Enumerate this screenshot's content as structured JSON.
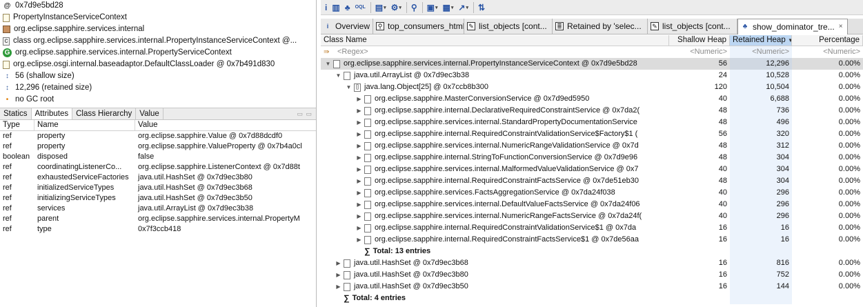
{
  "left": {
    "info": [
      {
        "icon": "at-icon",
        "glyph": "@",
        "text": "0x7d9e5bd28"
      },
      {
        "icon": "document-icon",
        "glyph": "",
        "text": "PropertyInstanceServiceContext"
      },
      {
        "icon": "package-icon",
        "glyph": "",
        "text": "org.eclipse.sapphire.services.internal"
      },
      {
        "icon": "class-icon",
        "glyph": "c",
        "text": "class org.eclipse.sapphire.services.internal.PropertyInstanceServiceContext @..."
      },
      {
        "icon": "superclass-icon",
        "glyph": "G",
        "text": "org.eclipse.sapphire.services.internal.PropertyServiceContext"
      },
      {
        "icon": "classloader-icon",
        "glyph": "",
        "text": "org.eclipse.osgi.internal.baseadaptor.DefaultClassLoader @ 0x7b491d830"
      },
      {
        "icon": "shallow-size-icon",
        "glyph": "↕",
        "text": "56 (shallow size)"
      },
      {
        "icon": "retained-size-icon",
        "glyph": "↕",
        "text": "12,296 (retained size)"
      },
      {
        "icon": "gc-root-icon",
        "glyph": "•",
        "text": "no GC root"
      }
    ],
    "tabs": [
      "Statics",
      "Attributes",
      "Class Hierarchy",
      "Value"
    ],
    "active_tab": 1,
    "columns": [
      "Type",
      "Name",
      "Value"
    ],
    "rows": [
      {
        "type": "ref",
        "name": "property",
        "value": "org.eclipse.sapphire.Value @ 0x7d88dcdf0"
      },
      {
        "type": "ref",
        "name": "property",
        "value": "org.eclipse.sapphire.ValueProperty @ 0x7b4a0cl"
      },
      {
        "type": "boolean",
        "name": "disposed",
        "value": "false"
      },
      {
        "type": "ref",
        "name": "coordinatingListenerCo...",
        "value": "org.eclipse.sapphire.ListenerContext @ 0x7d88t"
      },
      {
        "type": "ref",
        "name": "exhaustedServiceFactories",
        "value": "java.util.HashSet @ 0x7d9ec3b80"
      },
      {
        "type": "ref",
        "name": "initializedServiceTypes",
        "value": "java.util.HashSet @ 0x7d9ec3b68"
      },
      {
        "type": "ref",
        "name": "initializingServiceTypes",
        "value": "java.util.HashSet @ 0x7d9ec3b50"
      },
      {
        "type": "ref",
        "name": "services",
        "value": "java.util.ArrayList @ 0x7d9ec3b38"
      },
      {
        "type": "ref",
        "name": "parent",
        "value": "org.eclipse.sapphire.services.internal.PropertyM"
      },
      {
        "type": "ref",
        "name": "type",
        "value": "0x7f3ccb418"
      }
    ]
  },
  "toolbar": {
    "buttons": [
      {
        "name": "info-button",
        "icon": "info-icon",
        "glyph": "i",
        "dropdown": false
      },
      {
        "name": "histogram-button",
        "icon": "histogram-icon",
        "glyph": "▥",
        "dropdown": false
      },
      {
        "name": "dominator-tree-button",
        "icon": "dominator-tree-icon",
        "glyph": "♣",
        "dropdown": false
      },
      {
        "name": "oql-button",
        "icon": "oql-icon",
        "glyph": "OQL",
        "dropdown": false
      },
      {
        "name": "reports-button",
        "icon": "reports-icon",
        "glyph": "▤",
        "dropdown": true
      },
      {
        "name": "query-browser-button",
        "icon": "gear-icon",
        "glyph": "⚙",
        "dropdown": true
      },
      {
        "name": "search-button",
        "icon": "search-icon",
        "glyph": "⚲",
        "dropdown": false
      },
      {
        "name": "group-button",
        "icon": "group-icon",
        "glyph": "▣",
        "dropdown": true
      },
      {
        "name": "columns-button",
        "icon": "columns-icon",
        "glyph": "▦",
        "dropdown": true
      },
      {
        "name": "export-button",
        "icon": "export-icon",
        "glyph": "↗",
        "dropdown": true
      },
      {
        "name": "pin-button",
        "icon": "pin-icon",
        "glyph": "⇅",
        "dropdown": false
      }
    ]
  },
  "tabs": [
    {
      "label": "Overview",
      "icon": "info-icon",
      "glyph": "i",
      "active": false
    },
    {
      "label": "top_consumers_html",
      "icon": "search-icon",
      "glyph": "⚲",
      "active": false
    },
    {
      "label": "list_objects [cont...",
      "icon": "document-icon",
      "glyph": "✎",
      "active": false
    },
    {
      "label": "Retained by 'selec...",
      "icon": "list-icon",
      "glyph": "≣",
      "active": false
    },
    {
      "label": "list_objects [cont...",
      "icon": "document-icon",
      "glyph": "✎",
      "active": false
    },
    {
      "label": "show_dominator_tre...",
      "icon": "tree-icon",
      "glyph": "♣",
      "active": true,
      "close": "×"
    }
  ],
  "table": {
    "columns": [
      "Class Name",
      "Shallow Heap",
      "Retained Heap",
      "Percentage"
    ],
    "sort_indicator": "▼",
    "regex_row": {
      "name": "<Regex>",
      "sh": "<Numeric>",
      "rh": "<Numeric>",
      "pc": "<Numeric>"
    },
    "rows": [
      {
        "indent": 0,
        "twisty": "▼",
        "icon": true,
        "name": "org.eclipse.sapphire.services.internal.PropertyInstanceServiceContext @ 0x7d9e5bd28",
        "sh": "56",
        "rh": "12,296",
        "pc": "0.00%",
        "selected": true
      },
      {
        "indent": 1,
        "twisty": "▼",
        "icon": true,
        "name": "java.util.ArrayList @ 0x7d9ec3b38",
        "sh": "24",
        "rh": "10,528",
        "pc": "0.00%"
      },
      {
        "indent": 2,
        "twisty": "▼",
        "icon": true,
        "glyph": "[]",
        "name": "java.lang.Object[25] @ 0x7ccb8b300",
        "sh": "120",
        "rh": "10,504",
        "pc": "0.00%"
      },
      {
        "indent": 3,
        "twisty": "▶",
        "icon": true,
        "name": "org.eclipse.sapphire.MasterConversionService @ 0x7d9ed5950",
        "sh": "40",
        "rh": "6,688",
        "pc": "0.00%"
      },
      {
        "indent": 3,
        "twisty": "▶",
        "icon": true,
        "name": "org.eclipse.sapphire.internal.DeclarativeRequiredConstraintService @ 0x7da2(",
        "sh": "48",
        "rh": "736",
        "pc": "0.00%"
      },
      {
        "indent": 3,
        "twisty": "▶",
        "icon": true,
        "name": "org.eclipse.sapphire.services.internal.StandardPropertyDocumentationService",
        "sh": "48",
        "rh": "496",
        "pc": "0.00%"
      },
      {
        "indent": 3,
        "twisty": "▶",
        "icon": true,
        "name": "org.eclipse.sapphire.internal.RequiredConstraintValidationService$Factory$1 (",
        "sh": "56",
        "rh": "320",
        "pc": "0.00%"
      },
      {
        "indent": 3,
        "twisty": "▶",
        "icon": true,
        "name": "org.eclipse.sapphire.services.internal.NumericRangeValidationService @ 0x7d",
        "sh": "48",
        "rh": "312",
        "pc": "0.00%"
      },
      {
        "indent": 3,
        "twisty": "▶",
        "icon": true,
        "name": "org.eclipse.sapphire.internal.StringToFunctionConversionService @ 0x7d9e96",
        "sh": "48",
        "rh": "304",
        "pc": "0.00%"
      },
      {
        "indent": 3,
        "twisty": "▶",
        "icon": true,
        "name": "org.eclipse.sapphire.services.internal.MalformedValueValidationService @ 0x7",
        "sh": "40",
        "rh": "304",
        "pc": "0.00%"
      },
      {
        "indent": 3,
        "twisty": "▶",
        "icon": true,
        "name": "org.eclipse.sapphire.internal.RequiredConstraintFactsService @ 0x7de51eb30",
        "sh": "48",
        "rh": "304",
        "pc": "0.00%"
      },
      {
        "indent": 3,
        "twisty": "▶",
        "icon": true,
        "name": "org.eclipse.sapphire.services.FactsAggregationService @ 0x7da24f038",
        "sh": "40",
        "rh": "296",
        "pc": "0.00%"
      },
      {
        "indent": 3,
        "twisty": "▶",
        "icon": true,
        "name": "org.eclipse.sapphire.services.internal.DefaultValueFactsService @ 0x7da24f06",
        "sh": "40",
        "rh": "296",
        "pc": "0.00%"
      },
      {
        "indent": 3,
        "twisty": "▶",
        "icon": true,
        "name": "org.eclipse.sapphire.services.internal.NumericRangeFactsService @ 0x7da24f(",
        "sh": "40",
        "rh": "296",
        "pc": "0.00%"
      },
      {
        "indent": 3,
        "twisty": "▶",
        "icon": true,
        "name": "org.eclipse.sapphire.internal.RequiredConstraintValidationService$1 @ 0x7da",
        "sh": "16",
        "rh": "16",
        "pc": "0.00%"
      },
      {
        "indent": 3,
        "twisty": "▶",
        "icon": true,
        "name": "org.eclipse.sapphire.internal.RequiredConstraintFactsService$1 @ 0x7de56aa",
        "sh": "16",
        "rh": "16",
        "pc": "0.00%"
      },
      {
        "indent": 3,
        "twisty": "",
        "icon": false,
        "sum": "∑",
        "name": "Total: 13 entries",
        "sh": "",
        "rh": "",
        "pc": "",
        "bold": true
      },
      {
        "indent": 1,
        "twisty": "▶",
        "icon": true,
        "name": "java.util.HashSet @ 0x7d9ec3b68",
        "sh": "16",
        "rh": "816",
        "pc": "0.00%"
      },
      {
        "indent": 1,
        "twisty": "▶",
        "icon": true,
        "name": "java.util.HashSet @ 0x7d9ec3b80",
        "sh": "16",
        "rh": "752",
        "pc": "0.00%"
      },
      {
        "indent": 1,
        "twisty": "▶",
        "icon": true,
        "name": "java.util.HashSet @ 0x7d9ec3b50",
        "sh": "16",
        "rh": "144",
        "pc": "0.00%"
      },
      {
        "indent": 1,
        "twisty": "",
        "icon": false,
        "sum": "∑",
        "name": "Total: 4 entries",
        "sh": "",
        "rh": "",
        "pc": "",
        "bold": true
      }
    ]
  },
  "colors": {
    "sort_header": "#bcd6f2",
    "selected_row": "#dcdcdc",
    "accent": "#2a55a5"
  }
}
